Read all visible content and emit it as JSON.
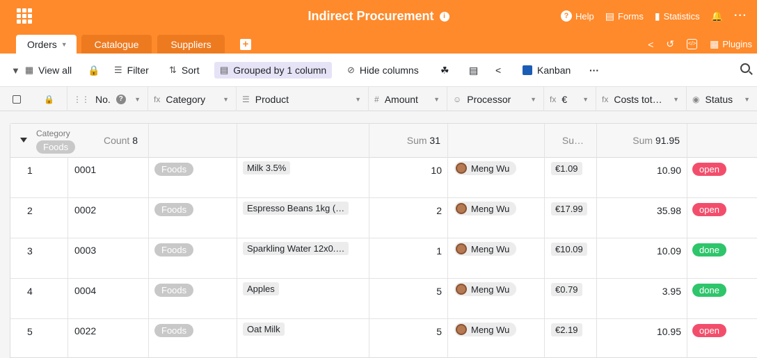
{
  "app": {
    "title": "Indirect Procurement",
    "info_icon": "info-icon",
    "header_actions": [
      {
        "label": "Help",
        "icon": "help-icon"
      },
      {
        "label": "Forms",
        "icon": "forms-icon"
      },
      {
        "label": "Statistics",
        "icon": "statistics-icon"
      }
    ],
    "plugins_label": "Plugins",
    "colors": {
      "brand": "#ff8a2b",
      "open": "#f24e6b",
      "done": "#2ec56b",
      "grouped_bg": "#e6e3f7"
    }
  },
  "tabs": [
    {
      "label": "Orders",
      "active": true
    },
    {
      "label": "Catalogue",
      "active": false
    },
    {
      "label": "Suppliers",
      "active": false
    }
  ],
  "toolbar": {
    "view": "View all",
    "filter": "Filter",
    "sort": "Sort",
    "grouped": "Grouped by 1 column",
    "hide": "Hide columns",
    "kanban": "Kanban"
  },
  "columns": {
    "no": "No.",
    "category": "Category",
    "product": "Product",
    "amount": "Amount",
    "processor": "Processor",
    "price": "€",
    "costs": "Costs tot…",
    "status": "Status"
  },
  "group": {
    "label": "Category",
    "value": "Foods",
    "count_label": "Count",
    "count": "8",
    "amount_sum_label": "Sum",
    "amount_sum": "31",
    "price_sum_label": "Su…",
    "costs_sum_label": "Sum",
    "costs_sum": "91.95"
  },
  "rows": [
    {
      "index": "1",
      "no": "0001",
      "category": "Foods",
      "product": "Milk 3.5%",
      "amount": "10",
      "processor": "Meng Wu",
      "price": "€1.09",
      "costs": "10.90",
      "status": "open"
    },
    {
      "index": "2",
      "no": "0002",
      "category": "Foods",
      "product": "Espresso Beans 1kg (…",
      "amount": "2",
      "processor": "Meng Wu",
      "price": "€17.99",
      "costs": "35.98",
      "status": "open"
    },
    {
      "index": "3",
      "no": "0003",
      "category": "Foods",
      "product": "Sparkling Water 12x0.…",
      "amount": "1",
      "processor": "Meng Wu",
      "price": "€10.09",
      "costs": "10.09",
      "status": "done"
    },
    {
      "index": "4",
      "no": "0004",
      "category": "Foods",
      "product": "Apples",
      "amount": "5",
      "processor": "Meng Wu",
      "price": "€0.79",
      "costs": "3.95",
      "status": "done"
    },
    {
      "index": "5",
      "no": "0022",
      "category": "Foods",
      "product": "Oat Milk",
      "amount": "5",
      "processor": "Meng Wu",
      "price": "€2.19",
      "costs": "10.95",
      "status": "open"
    }
  ]
}
